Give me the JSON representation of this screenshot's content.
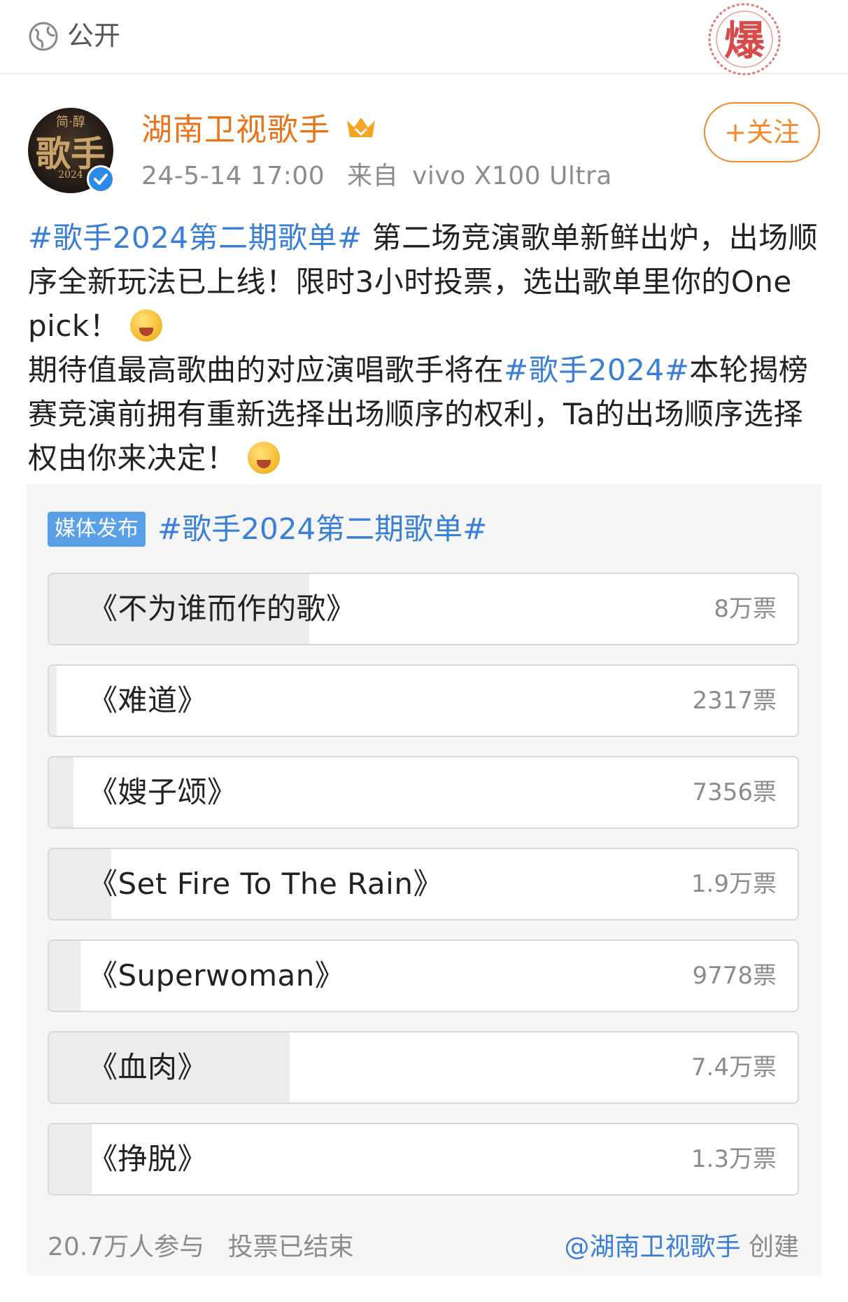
{
  "visibility": {
    "label": "公开",
    "icon": "globe-icon"
  },
  "stamp": {
    "text": "爆",
    "color": "#d94a4a"
  },
  "author": {
    "name": "湖南卫视歌手",
    "avatar_text_top": "简·醇",
    "avatar_text_main": "歌手",
    "avatar_text_year": "2024",
    "timestamp": "24-5-14 17:00",
    "source_prefix": "来自",
    "source_device": "vivo X100 Ultra",
    "follow_label": "+关注"
  },
  "post": {
    "hashtag1": "#歌手2024第二期歌单#",
    "text1": " 第二场竞演歌单新鲜出炉，出场顺序全新玩法已上线！限时3小时投票，选出歌单里你的One pick！",
    "text2": "期待值最高歌曲的对应演唱歌手将在",
    "hashtag2": "#歌手2024#",
    "text3": "本轮揭榜赛竞演前拥有重新选择出场顺序的权利，Ta的出场顺序选择权由你来决定！"
  },
  "poll": {
    "badge": "媒体发布",
    "title": "#歌手2024第二期歌单#",
    "options": [
      {
        "label": "《不为谁而作的歌》",
        "count": "8万票",
        "share": 0.386
      },
      {
        "label": "《难道》",
        "count": "2317票",
        "share": 0.011
      },
      {
        "label": "《嫂子颂》",
        "count": "7356票",
        "share": 0.036
      },
      {
        "label": "《Set Fire To The Rain》",
        "count": "1.9万票",
        "share": 0.092
      },
      {
        "label": "《Superwoman》",
        "count": "9778票",
        "share": 0.047
      },
      {
        "label": "《血肉》",
        "count": "7.4万票",
        "share": 0.357
      },
      {
        "label": "《挣脱》",
        "count": "1.3万票",
        "share": 0.063
      }
    ],
    "participants": "20.7万人参与",
    "status": "投票已结束",
    "creator": "@湖南卫视歌手",
    "creator_suffix": " 创建"
  },
  "colors": {
    "accent_orange": "#e8741b",
    "link_blue": "#3a7fd6",
    "verified_blue": "#2b8ae8"
  }
}
